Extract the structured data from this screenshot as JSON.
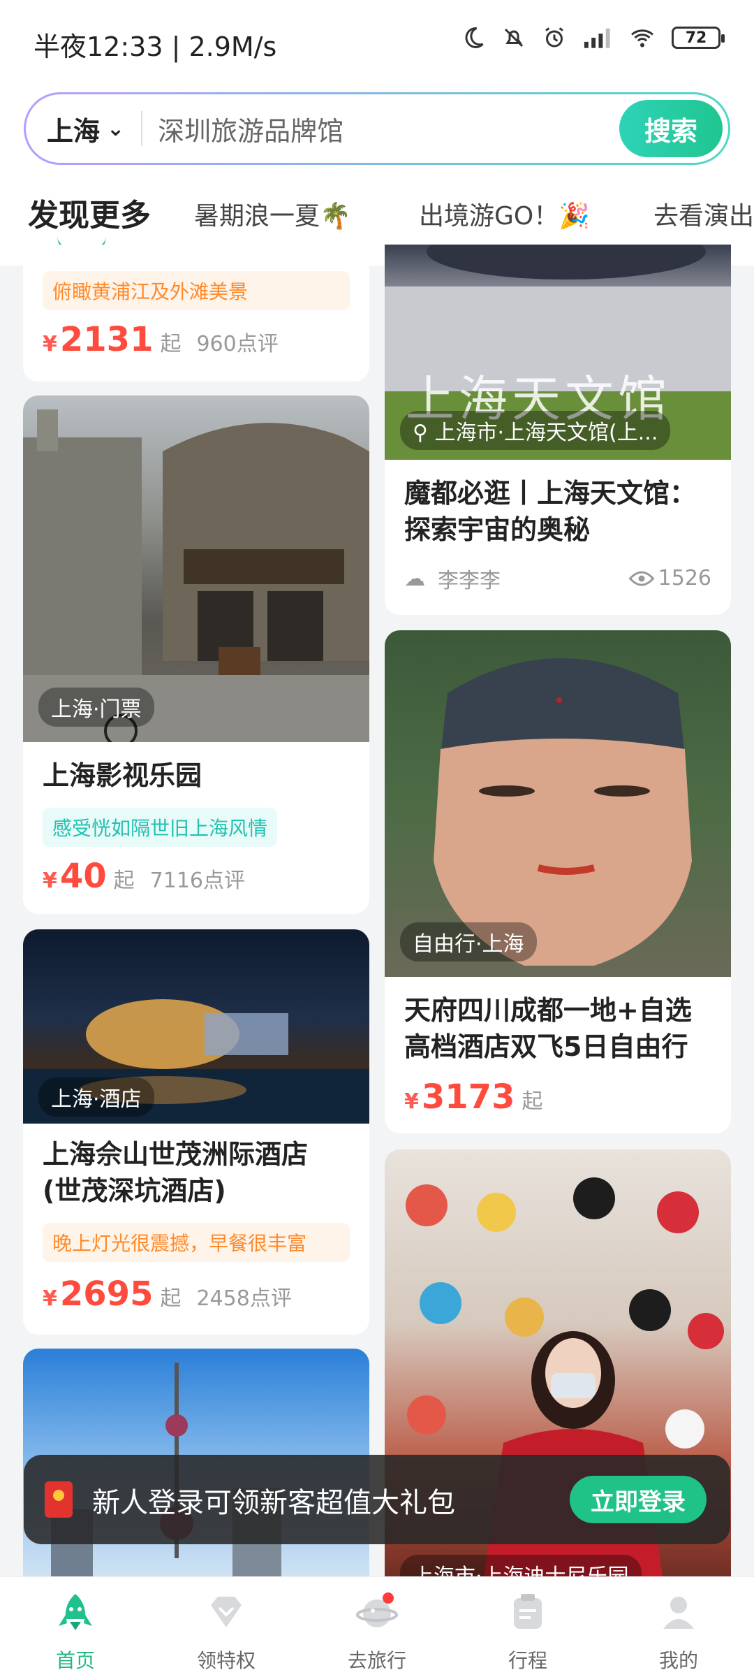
{
  "status_bar": {
    "time_speed": "半夜12:33 | 2.9M/s",
    "battery": "72"
  },
  "search": {
    "city": "上海",
    "query": "深圳旅游品牌馆",
    "button": "搜索"
  },
  "tabs": [
    "发现更多",
    "暑期浪一夏🌴",
    "出境游GO！🎉",
    "去看演出"
  ],
  "cards": {
    "bund": {
      "tag": "俯瞰黄浦江及外滩美景",
      "yen": "¥",
      "price": "2131",
      "qi": "起",
      "reviews": "960点评"
    },
    "film_park": {
      "location": "上海·门票",
      "title": "上海影视乐园",
      "tag": "感受恍如隔世旧上海风情",
      "yen": "¥",
      "price": "40",
      "qi": "起",
      "reviews": "7116点评"
    },
    "hotel": {
      "location": "上海·酒店",
      "title_line1": "上海佘山世茂洲际酒店",
      "title_line2": "(世茂深坑酒店)",
      "tag": "晚上灯光很震撼，早餐很丰富",
      "yen": "¥",
      "price": "2695",
      "qi": "起",
      "reviews": "2458点评"
    },
    "planetarium": {
      "location": "上海市·上海天文馆(上...",
      "sign_text": "上海天文馆",
      "title_line1": "魔都必逛丨上海天文馆：",
      "title_line2": "探索宇宙的奥秘",
      "author": "李李李",
      "views": "1526"
    },
    "chengdu": {
      "location": "自由行·上海",
      "title_line1": "天府四川成都一地+自选",
      "title_line2": "高档酒店双飞5日自由行",
      "yen": "¥",
      "price": "3173",
      "qi": "起"
    },
    "disney": {
      "location": "上海市·上海迪士尼乐园"
    }
  },
  "banner": {
    "text": "新人登录可领新客超值大礼包",
    "button": "立即登录"
  },
  "bottom_nav": [
    {
      "label": "首页",
      "icon": "home-rocket-icon"
    },
    {
      "label": "领特权",
      "icon": "privilege-diamond-icon"
    },
    {
      "label": "去旅行",
      "icon": "travel-planet-icon"
    },
    {
      "label": "行程",
      "icon": "itinerary-icon"
    },
    {
      "label": "我的",
      "icon": "profile-icon"
    }
  ],
  "colors": {
    "accent": "#21c08a",
    "price": "#ff4b3e"
  }
}
